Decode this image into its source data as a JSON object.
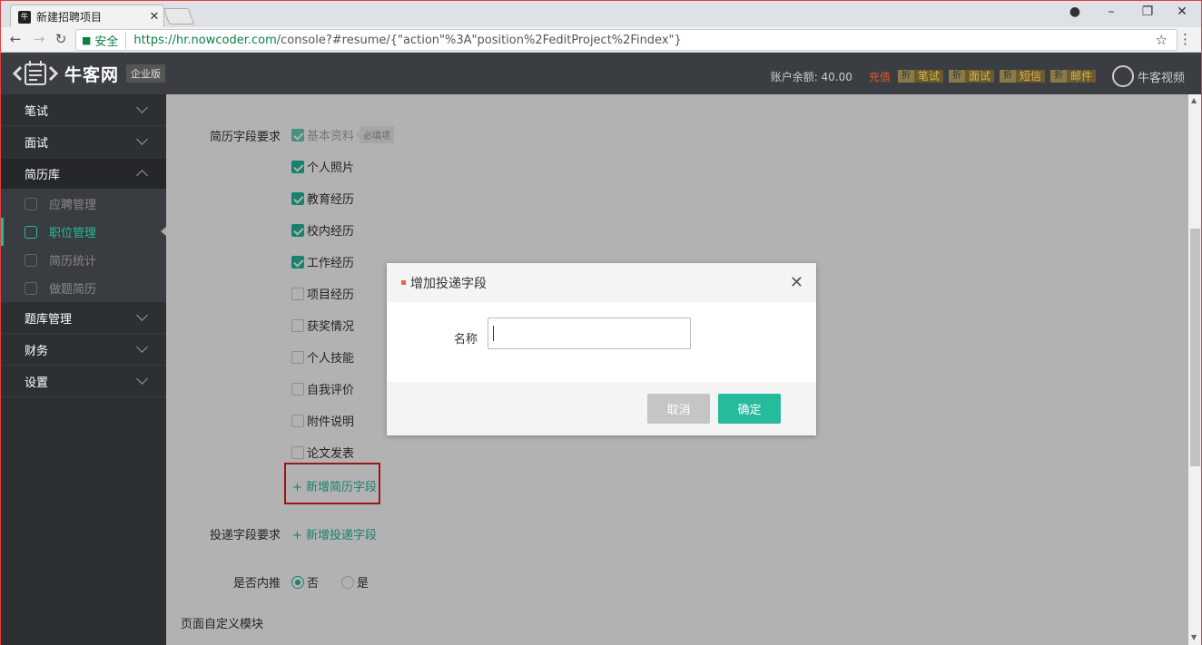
{
  "browser": {
    "tab_title": "新建招聘项目",
    "tab_favicon": "牛",
    "secure_label": "安全",
    "url_host": "https://hr.nowcoder.com",
    "url_rest": "/console?#resume/{\"action\"%3A\"position%2FeditProject%2Findex\"}"
  },
  "header": {
    "logo_text": "牛客网",
    "logo_badge": "企业版",
    "balance": "账户余额: 40.00",
    "recharge": "充值",
    "services": [
      {
        "tag": "折",
        "label": "笔试"
      },
      {
        "tag": "折",
        "label": "面试"
      },
      {
        "tag": "折",
        "label": "短信"
      },
      {
        "tag": "折",
        "label": "邮件"
      }
    ],
    "video_label": "牛客视频"
  },
  "sidebar": {
    "items": [
      {
        "label": "笔试"
      },
      {
        "label": "面试"
      },
      {
        "label": "简历库"
      },
      {
        "label": "题库管理"
      },
      {
        "label": "财务"
      },
      {
        "label": "设置"
      }
    ],
    "sub_items": [
      {
        "label": "应聘管理"
      },
      {
        "label": "职位管理"
      },
      {
        "label": "简历统计"
      },
      {
        "label": "做题简历"
      }
    ]
  },
  "form": {
    "resume_fields_label": "简历字段要求",
    "required_tag": "必填项",
    "fields": [
      {
        "label": "基本资料",
        "checked": true
      },
      {
        "label": "个人照片",
        "checked": true
      },
      {
        "label": "教育经历",
        "checked": true
      },
      {
        "label": "校内经历",
        "checked": true
      },
      {
        "label": "工作经历",
        "checked": true
      },
      {
        "label": "项目经历",
        "checked": false
      },
      {
        "label": "获奖情况",
        "checked": false
      },
      {
        "label": "个人技能",
        "checked": false
      },
      {
        "label": "自我评价",
        "checked": false
      },
      {
        "label": "附件说明",
        "checked": false
      },
      {
        "label": "论文发表",
        "checked": false
      }
    ],
    "add_resume_field": "+ 新增简历字段",
    "delivery_fields_label": "投递字段要求",
    "add_delivery_field": "+ 新增投递字段",
    "referral_label": "是否内推",
    "referral_no": "否",
    "referral_yes": "是",
    "custom_module_title": "页面自定义模块"
  },
  "modal": {
    "title": "增加投递字段",
    "name_label": "名称",
    "name_value": "",
    "cancel": "取消",
    "confirm": "确定"
  }
}
